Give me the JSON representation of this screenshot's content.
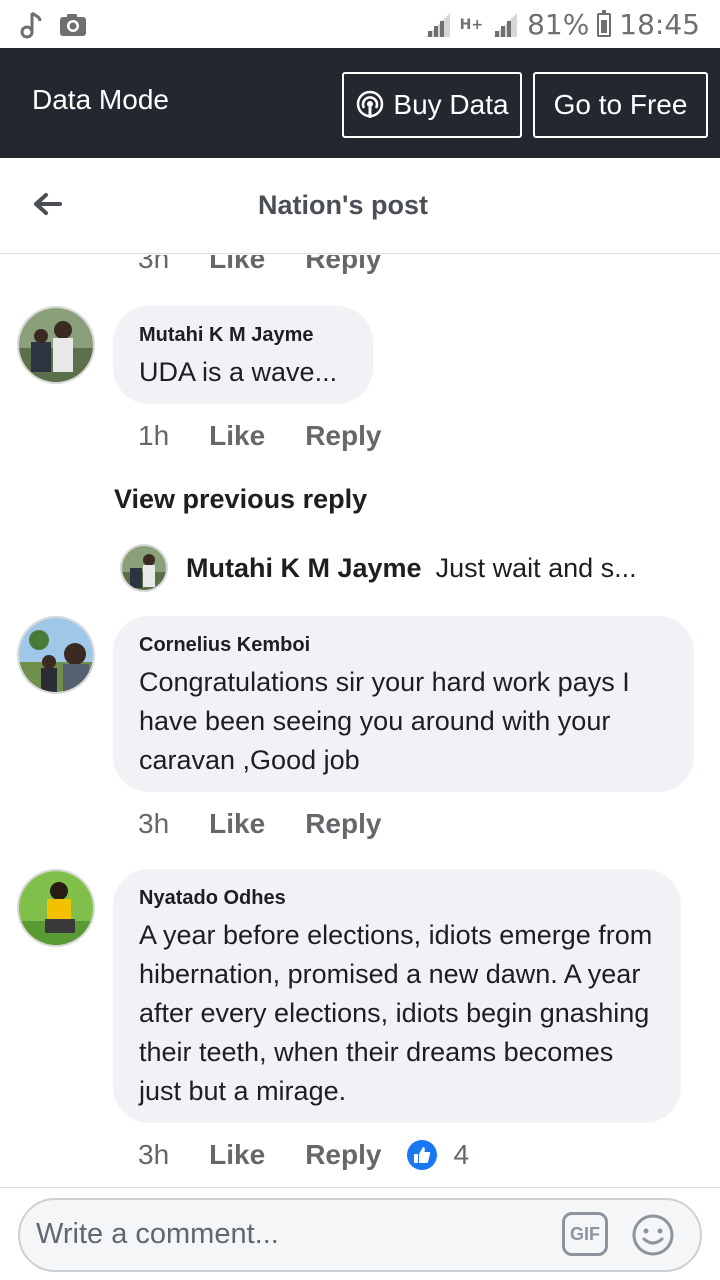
{
  "status_bar": {
    "battery": "81%",
    "time": "18:45",
    "network": "H+",
    "icons": [
      "music-note-icon",
      "camera-icon",
      "signal-icon",
      "battery-icon"
    ]
  },
  "data_mode": {
    "title": "Data Mode",
    "buy_data": "Buy Data",
    "go_to_free": "Go to Free"
  },
  "nav": {
    "title": "Nation's post"
  },
  "partial_actions": {
    "time": "3h",
    "like": "Like",
    "reply": "Reply"
  },
  "comments": [
    {
      "author": "Mutahi K  M Jayme",
      "text": "UDA is a wave...",
      "time": "1h",
      "like": "Like",
      "reply": "Reply"
    },
    {
      "author": "Cornelius Kemboi",
      "text": "Congratulations sir your hard work pays I have been seeing you around with your caravan ,Good job",
      "time": "3h",
      "like": "Like",
      "reply": "Reply"
    },
    {
      "author": "Nyatado Odhes",
      "text": "A year before elections, idiots emerge from hibernation, promised a new dawn. A year after every elections, idiots begin gnashing their teeth, when their dreams becomes just but a mirage.",
      "time": "3h",
      "like": "Like",
      "reply": "Reply",
      "reaction_count": "4"
    }
  ],
  "view_previous_reply": "View previous reply",
  "reply_preview": {
    "author": "Mutahi K  M Jayme",
    "text": "Just wait and s..."
  },
  "composer": {
    "placeholder": "Write a comment...",
    "gif": "GIF"
  },
  "colors": {
    "header_bg": "#232730",
    "bubble_bg": "#f0f2f5",
    "like_blue": "#1877f2"
  }
}
